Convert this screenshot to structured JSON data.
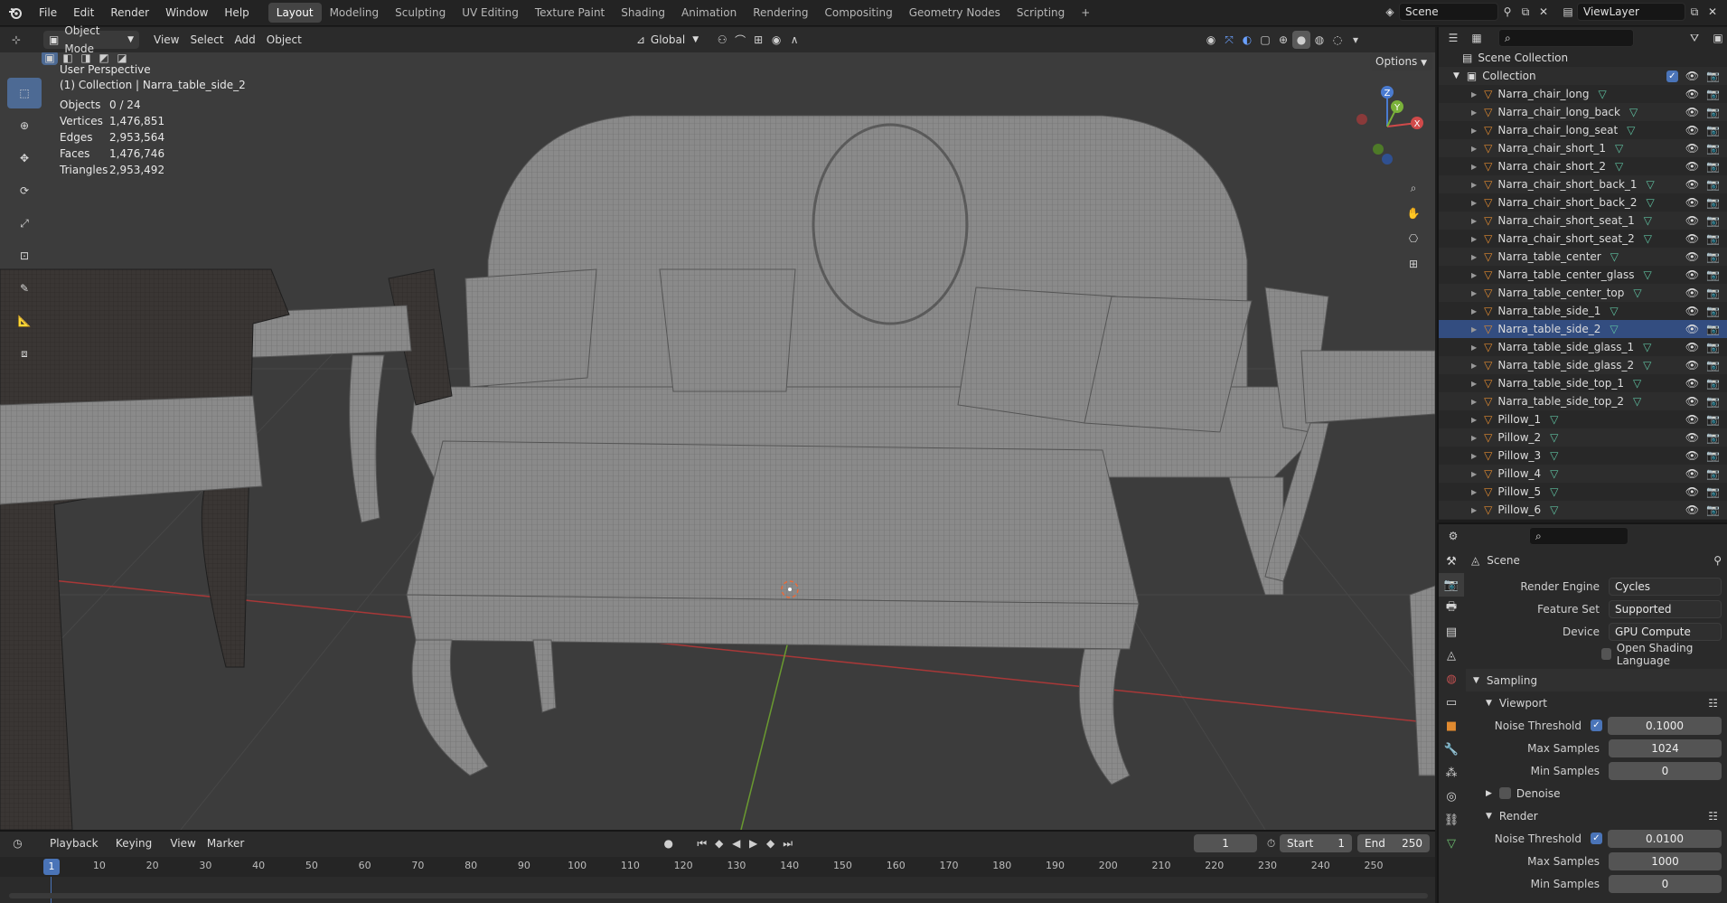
{
  "topbar": {
    "menus": [
      "File",
      "Edit",
      "Render",
      "Window",
      "Help"
    ],
    "workspaces": [
      "Layout",
      "Modeling",
      "Sculpting",
      "UV Editing",
      "Texture Paint",
      "Shading",
      "Animation",
      "Rendering",
      "Compositing",
      "Geometry Nodes",
      "Scripting"
    ],
    "active_workspace": "Layout",
    "add_workspace": "+",
    "scene_name": "Scene",
    "view_layer": "ViewLayer"
  },
  "viewport_header": {
    "mode": "Object Mode",
    "menus": [
      "View",
      "Select",
      "Add",
      "Object"
    ],
    "transform_orientation": "Global",
    "options_label": "Options"
  },
  "overlay": {
    "view_name": "User Perspective",
    "collection_info": "(1) Collection | Narra_table_side_2",
    "stats": [
      {
        "label": "Objects",
        "value": "0 / 24"
      },
      {
        "label": "Vertices",
        "value": "1,476,851"
      },
      {
        "label": "Edges",
        "value": "2,953,564"
      },
      {
        "label": "Faces",
        "value": "1,476,746"
      },
      {
        "label": "Triangles",
        "value": "2,953,492"
      }
    ]
  },
  "gizmo": {
    "x": "X",
    "y": "Y",
    "z": "Z"
  },
  "outliner": {
    "scene_collection": "Scene Collection",
    "collection": "Collection",
    "items": [
      "Narra_chair_long",
      "Narra_chair_long_back",
      "Narra_chair_long_seat",
      "Narra_chair_short_1",
      "Narra_chair_short_2",
      "Narra_chair_short_back_1",
      "Narra_chair_short_back_2",
      "Narra_chair_short_seat_1",
      "Narra_chair_short_seat_2",
      "Narra_table_center",
      "Narra_table_center_glass",
      "Narra_table_center_top",
      "Narra_table_side_1",
      "Narra_table_side_2",
      "Narra_table_side_glass_1",
      "Narra_table_side_glass_2",
      "Narra_table_side_top_1",
      "Narra_table_side_top_2",
      "Pillow_1",
      "Pillow_2",
      "Pillow_3",
      "Pillow_4",
      "Pillow_5",
      "Pillow_6"
    ],
    "active_item": "Narra_table_side_2"
  },
  "properties": {
    "context_title": "Scene",
    "render_engine": {
      "label": "Render Engine",
      "value": "Cycles"
    },
    "feature_set": {
      "label": "Feature Set",
      "value": "Supported"
    },
    "device": {
      "label": "Device",
      "value": "GPU Compute"
    },
    "osl": "Open Shading Language",
    "sampling": "Sampling",
    "viewport": {
      "title": "Viewport",
      "noise_threshold": {
        "label": "Noise Threshold",
        "value": "0.1000"
      },
      "max_samples": {
        "label": "Max Samples",
        "value": "1024"
      },
      "min_samples": {
        "label": "Min Samples",
        "value": "0"
      }
    },
    "denoise": "Denoise",
    "render": {
      "title": "Render",
      "noise_threshold": {
        "label": "Noise Threshold",
        "value": "0.0100"
      },
      "max_samples": {
        "label": "Max Samples",
        "value": "1000"
      },
      "min_samples": {
        "label": "Min Samples",
        "value": "0"
      }
    }
  },
  "timeline": {
    "menus": [
      "Playback",
      "Keying",
      "View",
      "Marker"
    ],
    "current_frame": "1",
    "start_label": "Start",
    "start": "1",
    "end_label": "End",
    "end": "250",
    "ticks": [
      "1",
      "10",
      "20",
      "30",
      "40",
      "50",
      "60",
      "70",
      "80",
      "90",
      "100",
      "110",
      "120",
      "130",
      "140",
      "150",
      "160",
      "170",
      "180",
      "190",
      "200",
      "210",
      "220",
      "230",
      "240",
      "250"
    ]
  }
}
